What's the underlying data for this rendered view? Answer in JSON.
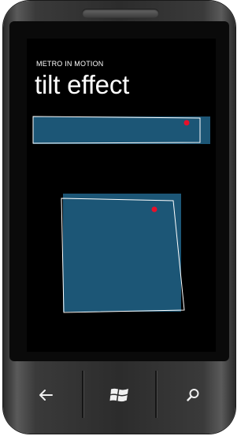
{
  "app": {
    "title": "METRO IN MOTION",
    "page_title": "tilt effect"
  },
  "tilt_demo": {
    "tile_color": "#1c5676",
    "outline_color": "#ffffff",
    "touch_point_color": "#e8102a"
  },
  "hardware_buttons": [
    {
      "name": "back",
      "icon": "back-arrow-icon"
    },
    {
      "name": "start",
      "icon": "windows-logo-icon"
    },
    {
      "name": "search",
      "icon": "search-icon"
    }
  ]
}
